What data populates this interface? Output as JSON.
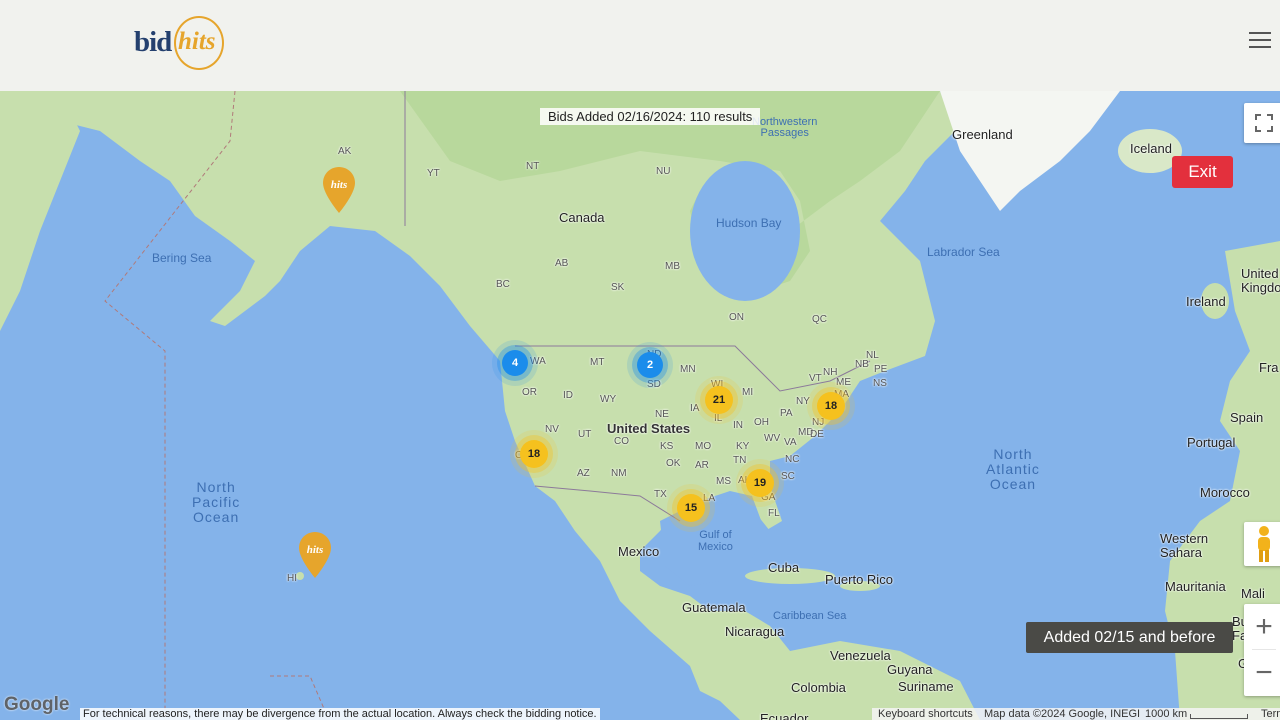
{
  "header": {
    "logo_bid": "bid",
    "logo_hits": "hits",
    "menu_icon": "hamburger-icon"
  },
  "map": {
    "title": "Bids Added 02/16/2024: 110 results",
    "exit_label": "Exit",
    "legend_label": "Added 02/15 and before",
    "zoom_in": "+",
    "zoom_out": "−",
    "google": "Google",
    "disclaimer": "For technical reasons, there may be divergence from the actual location. Always check the bidding notice.",
    "attribution": {
      "keyboard": "Keyboard shortcuts",
      "mapdata": "Map data ©2024 Google, INEGI",
      "scale": "1000 km",
      "terms": "Terms"
    },
    "colors": {
      "recent_cluster": "#1b8ceb",
      "older_cluster": "#f5c11e",
      "pin": "#e6a52c",
      "exit": "#e3303d"
    },
    "clusters": [
      {
        "count": "4",
        "kind": "blue"
      },
      {
        "count": "2",
        "kind": "blue"
      },
      {
        "count": "21",
        "kind": "yellow"
      },
      {
        "count": "18",
        "kind": "yellow"
      },
      {
        "count": "18",
        "kind": "yellow"
      },
      {
        "count": "19",
        "kind": "yellow"
      },
      {
        "count": "15",
        "kind": "yellow"
      }
    ],
    "pin_text": "hits",
    "labels": {
      "greenland": "Greenland",
      "iceland": "Iceland",
      "canada": "Canada",
      "hudson_bay": "Hudson Bay",
      "nw_passages": "Northwestern\nPassages",
      "labrador_sea": "Labrador Sea",
      "bering_sea": "Bering Sea",
      "united_states": "United States",
      "mexico": "Mexico",
      "gulf_mexico": "Gulf of\nMexico",
      "cuba": "Cuba",
      "puerto_rico": "Puerto Rico",
      "guatemala": "Guatemala",
      "nicaragua": "Nicaragua",
      "caribbean_sea": "Caribbean Sea",
      "venezuela": "Venezuela",
      "guyana": "Guyana",
      "suriname": "Suriname",
      "colombia": "Colombia",
      "ecuador": "Ecuador",
      "north_pacific": "North\nPacific\nOcean",
      "north_atlantic": "North\nAtlantic\nOcean",
      "united_kingdom": "United\nKingdom",
      "ireland": "Ireland",
      "france": "Fra",
      "spain": "Spain",
      "portugal": "Portugal",
      "morocco": "Morocco",
      "western_sahara": "Western\nSahara",
      "mauritania": "Mauritania",
      "mali": "Mali",
      "burkina": "Bu\nFa",
      "ghana": "G",
      "ak": "AK",
      "yt": "YT",
      "nt": "NT",
      "nu": "NU",
      "bc": "BC",
      "ab": "AB",
      "sk": "SK",
      "mb": "MB",
      "on": "ON",
      "qc": "QC",
      "nb": "NB",
      "ns": "NS",
      "pe": "PE",
      "nl": "NL",
      "wa": "WA",
      "mt": "MT",
      "nd": "ND",
      "sd": "SD",
      "mn": "MN",
      "or": "OR",
      "id": "ID",
      "wy": "WY",
      "ne": "NE",
      "ia": "IA",
      "wi": "WI",
      "mi": "MI",
      "il": "IL",
      "in": "IN",
      "oh": "OH",
      "pa": "PA",
      "ny": "NY",
      "me": "ME",
      "nv": "NV",
      "ut": "UT",
      "co": "CO",
      "ks": "KS",
      "mo": "MO",
      "ky": "KY",
      "wv": "WV",
      "va": "VA",
      "md": "MD",
      "de": "DE",
      "nj": "NJ",
      "ct": "CT",
      "ri": "RI",
      "ma": "MA",
      "vt": "VT",
      "nh": "NH",
      "ca": "CA",
      "az": "AZ",
      "nm": "NM",
      "ok": "OK",
      "ar": "AR",
      "tn": "TN",
      "nc": "NC",
      "sc": "SC",
      "tx": "TX",
      "la": "LA",
      "ms": "MS",
      "al": "AL",
      "ga": "GA",
      "fl": "FL",
      "hi": "HI"
    }
  }
}
